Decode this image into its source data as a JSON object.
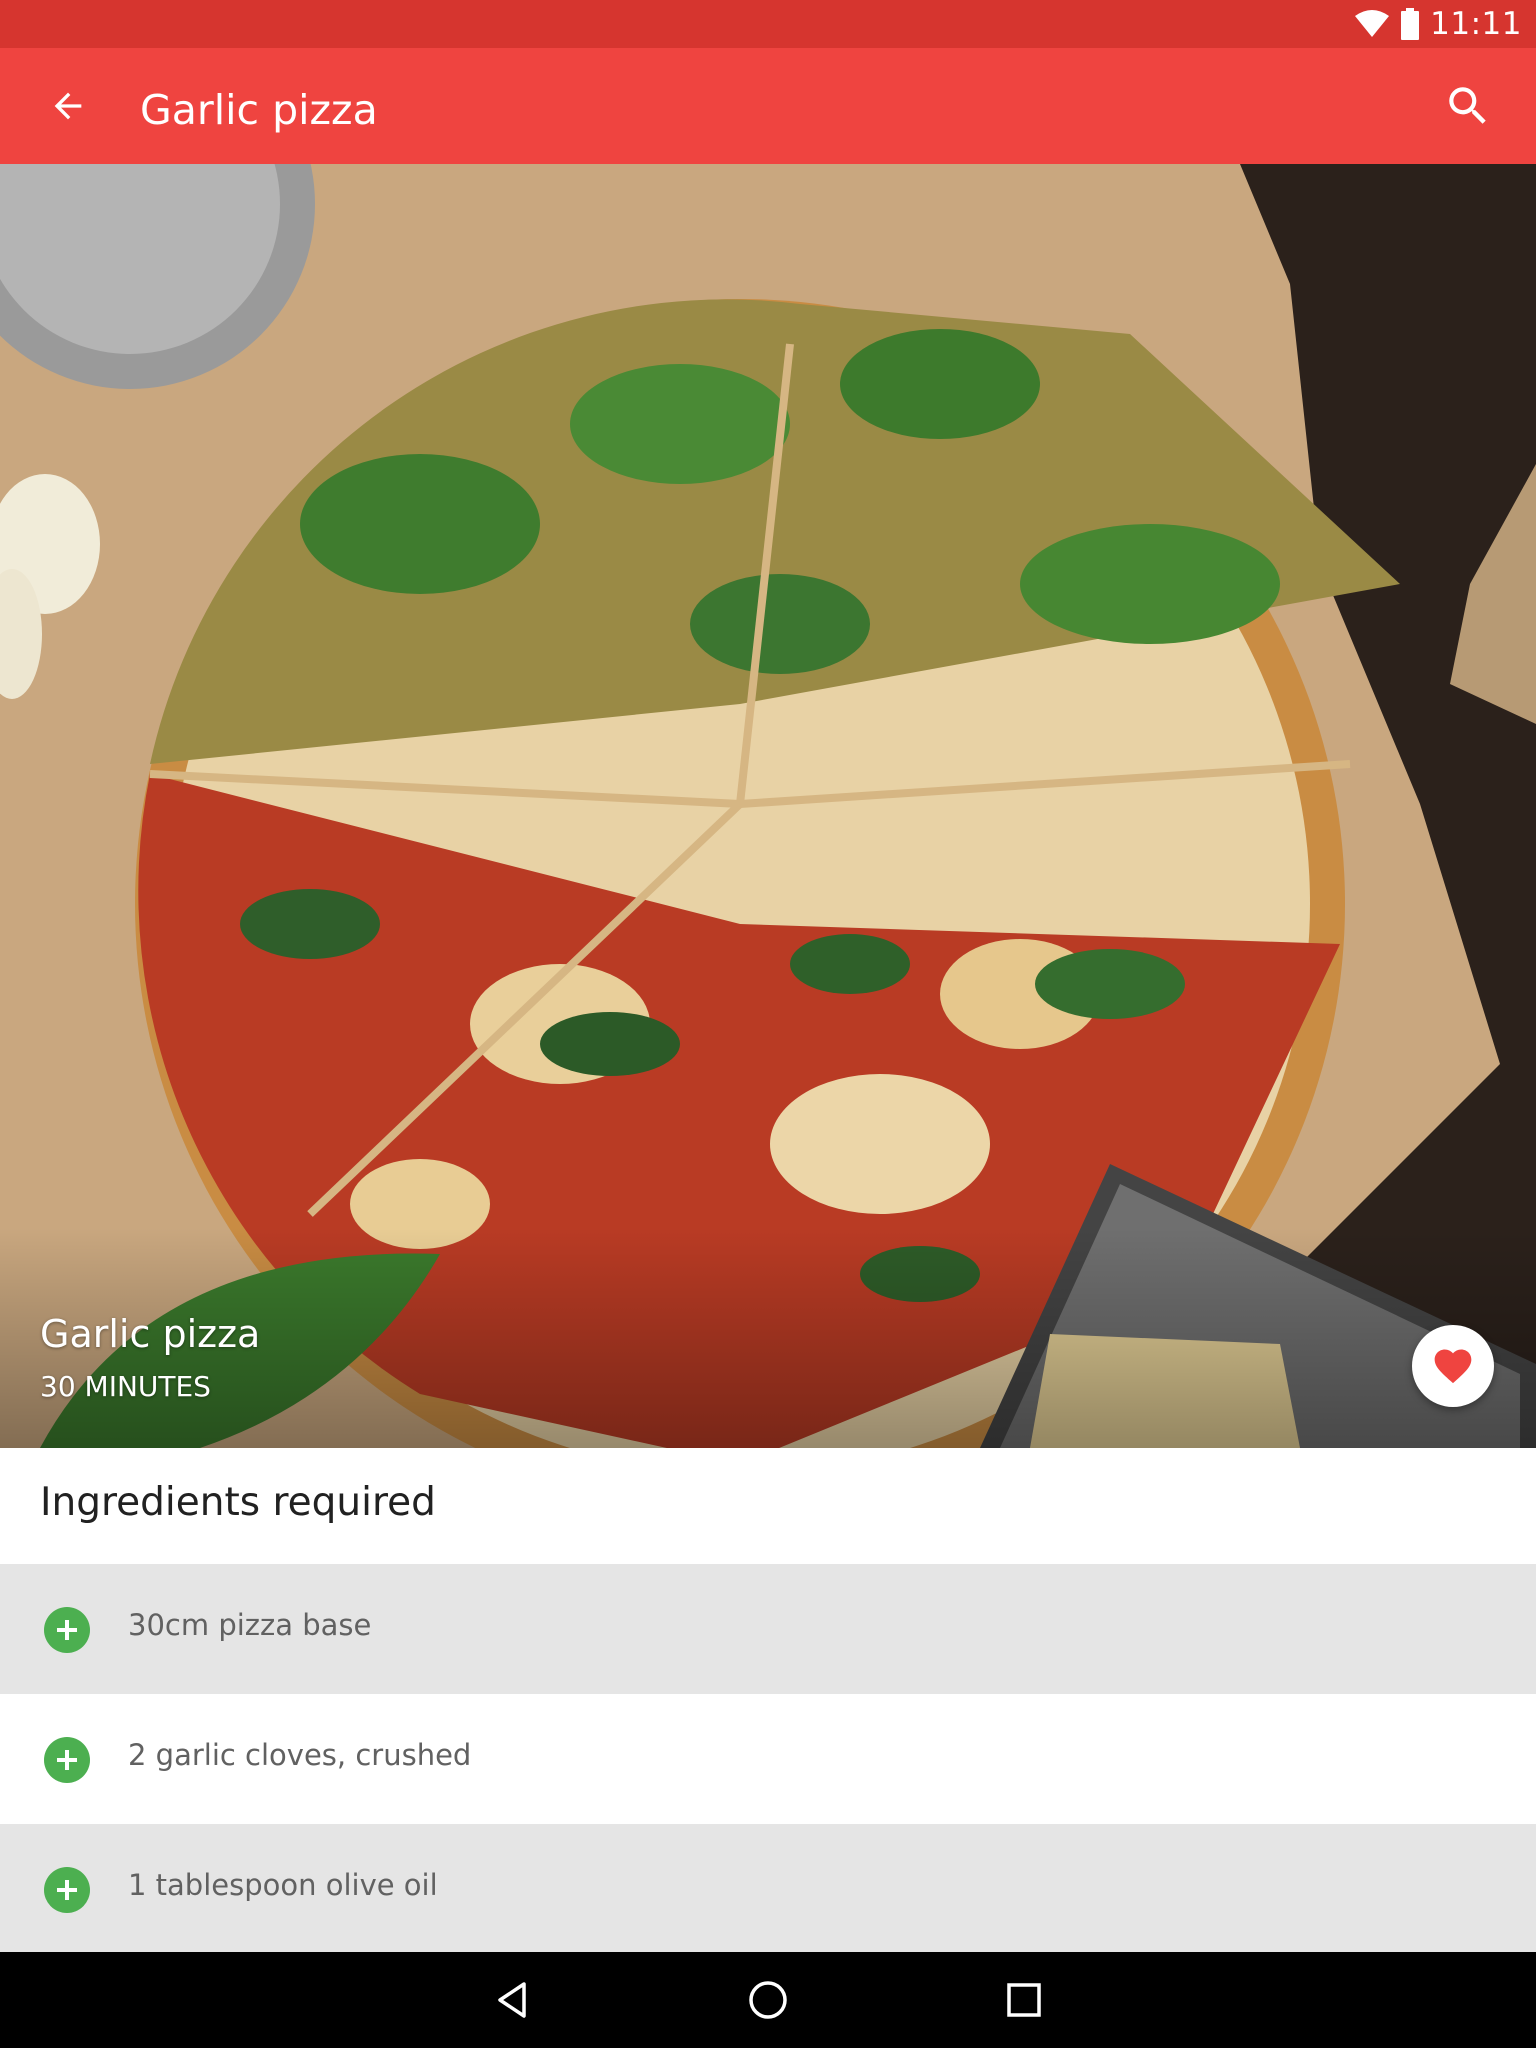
{
  "status_bar": {
    "time": "11:11",
    "icons": [
      "wifi-icon",
      "battery-icon"
    ]
  },
  "app_bar": {
    "title": "Garlic pizza",
    "back_icon": "arrow-back-icon",
    "search_icon": "search-icon",
    "color": "#ef4440"
  },
  "hero": {
    "title": "Garlic pizza",
    "subtitle": "30 MINUTES",
    "favorite_icon": "heart-icon",
    "favorite_color": "#ef4440"
  },
  "ingredients": {
    "heading": "Ingredients required",
    "items": [
      {
        "label": "30cm pizza base",
        "icon": "add-circle-icon"
      },
      {
        "label": "2 garlic cloves, crushed",
        "icon": "add-circle-icon"
      },
      {
        "label": "1 tablespoon olive oil",
        "icon": "add-circle-icon"
      }
    ],
    "accent": "#4caf50"
  },
  "nav_bar": {
    "buttons": [
      "back-triangle-icon",
      "home-circle-icon",
      "recents-square-icon"
    ]
  }
}
